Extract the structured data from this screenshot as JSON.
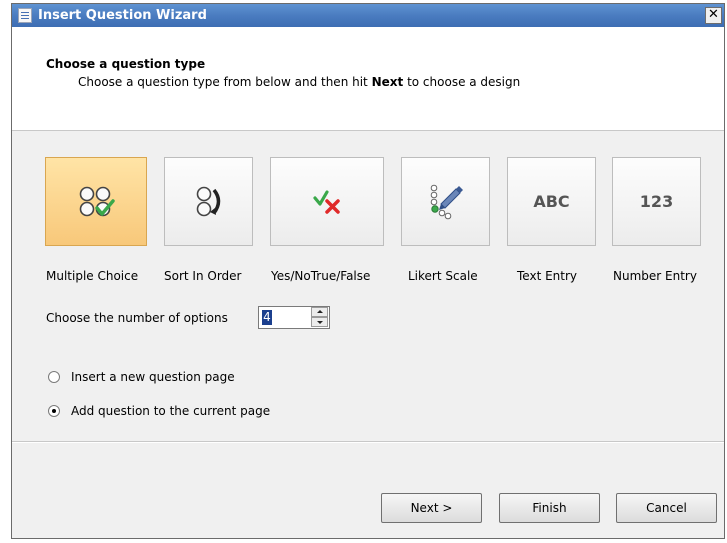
{
  "window": {
    "title": "Insert Question Wizard",
    "close_glyph": "✕"
  },
  "header": {
    "title": "Choose a question type",
    "subtitle_before": "Choose a question type from below and then hit ",
    "subtitle_bold": "Next",
    "subtitle_after": " to choose a design"
  },
  "question_types": [
    {
      "label": "Multiple Choice",
      "icon": "multiple-choice-icon",
      "selected": true
    },
    {
      "label": "Sort In Order",
      "icon": "sort-order-icon",
      "selected": false
    },
    {
      "label": "Yes/NoTrue/False",
      "icon": "yes-no-icon",
      "selected": false
    },
    {
      "label": "Likert Scale",
      "icon": "likert-scale-icon",
      "selected": false
    },
    {
      "label": "Text Entry",
      "icon_text": "ABC",
      "selected": false
    },
    {
      "label": "Number Entry",
      "icon_text": "123",
      "selected": false
    }
  ],
  "options": {
    "label": "Choose the number of options",
    "value": "4"
  },
  "placement": [
    {
      "label": "Insert a new question page",
      "checked": false
    },
    {
      "label": "Add question to the current page",
      "checked": true
    }
  ],
  "buttons": {
    "next": "Next >",
    "finish": "Finish",
    "cancel": "Cancel"
  },
  "colors": {
    "titlebar": "#4a7cc0",
    "selected_tile": "#f8c87a",
    "check_green": "#3aa84a",
    "x_red": "#e02a2a"
  }
}
